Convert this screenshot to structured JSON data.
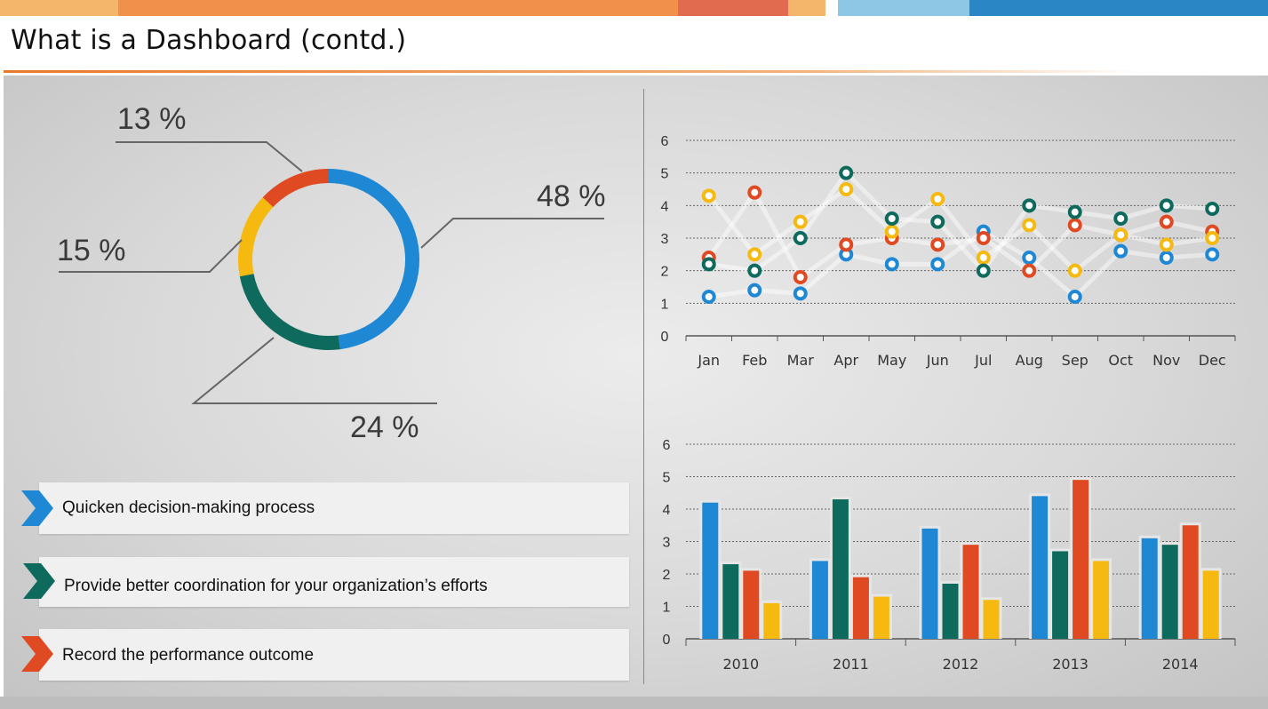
{
  "slide": {
    "title": "What is a Dashboard (contd.)",
    "top_bar_colors": [
      "#f4b66a",
      "#f0904a",
      "#e06b4e",
      "#f4b66a",
      "#ffffff",
      "#8cc8e6",
      "#2b86c6"
    ]
  },
  "donut": {
    "segments": [
      {
        "label": "48 %",
        "value": 48,
        "color": "#1f88d4"
      },
      {
        "label": "24 %",
        "value": 24,
        "color": "#0d6a5c"
      },
      {
        "label": "15 %",
        "value": 15,
        "color": "#f5b90f"
      },
      {
        "label": "13 %",
        "value": 13,
        "color": "#e04a22"
      }
    ]
  },
  "bullets": [
    {
      "text": "Quicken decision-making process",
      "color": "#1f88d4"
    },
    {
      "text": "Provide better coordination for your organization’s efforts",
      "color": "#0d6a5c"
    },
    {
      "text": "Record the performance outcome",
      "color": "#e04a22"
    }
  ],
  "chart_data": [
    {
      "type": "scatter",
      "categories": [
        "Jan",
        "Feb",
        "Mar",
        "Apr",
        "May",
        "Jun",
        "Jul",
        "Aug",
        "Sep",
        "Oct",
        "Nov",
        "Dec"
      ],
      "ylim": [
        0,
        6
      ],
      "yticks": [
        "0",
        "1",
        "2",
        "3",
        "4",
        "5",
        "6"
      ],
      "grid": true,
      "series": [
        {
          "color": "#1f88d4",
          "values": [
            1.2,
            1.4,
            1.3,
            2.5,
            2.2,
            2.2,
            3.2,
            2.4,
            1.2,
            2.6,
            2.4,
            2.5
          ]
        },
        {
          "color": "#e04a22",
          "values": [
            2.4,
            4.4,
            1.8,
            2.8,
            3.0,
            2.8,
            3.0,
            2.0,
            3.4,
            3.1,
            3.5,
            3.2
          ]
        },
        {
          "color": "#f5b90f",
          "values": [
            4.3,
            2.5,
            3.5,
            4.5,
            3.2,
            4.2,
            2.4,
            3.4,
            2.0,
            3.1,
            2.8,
            3.0
          ]
        },
        {
          "color": "#0d6a5c",
          "values": [
            2.2,
            2.0,
            3.0,
            5.0,
            3.6,
            3.5,
            2.0,
            4.0,
            3.8,
            3.6,
            4.0,
            3.9
          ]
        }
      ]
    },
    {
      "type": "bar",
      "categories": [
        "2010",
        "2011",
        "2012",
        "2013",
        "2014"
      ],
      "ylim": [
        0,
        6
      ],
      "yticks": [
        "0",
        "1",
        "2",
        "3",
        "4",
        "5",
        "6"
      ],
      "grid": true,
      "series": [
        {
          "color": "#1f88d4",
          "values": [
            4.2,
            2.4,
            3.4,
            4.4,
            3.1
          ]
        },
        {
          "color": "#0d6a5c",
          "values": [
            2.3,
            4.3,
            1.7,
            2.7,
            2.9
          ]
        },
        {
          "color": "#e04a22",
          "values": [
            2.1,
            1.9,
            2.9,
            4.9,
            3.5
          ]
        },
        {
          "color": "#f5b90f",
          "values": [
            1.1,
            1.3,
            1.2,
            2.4,
            2.1
          ]
        }
      ]
    }
  ]
}
